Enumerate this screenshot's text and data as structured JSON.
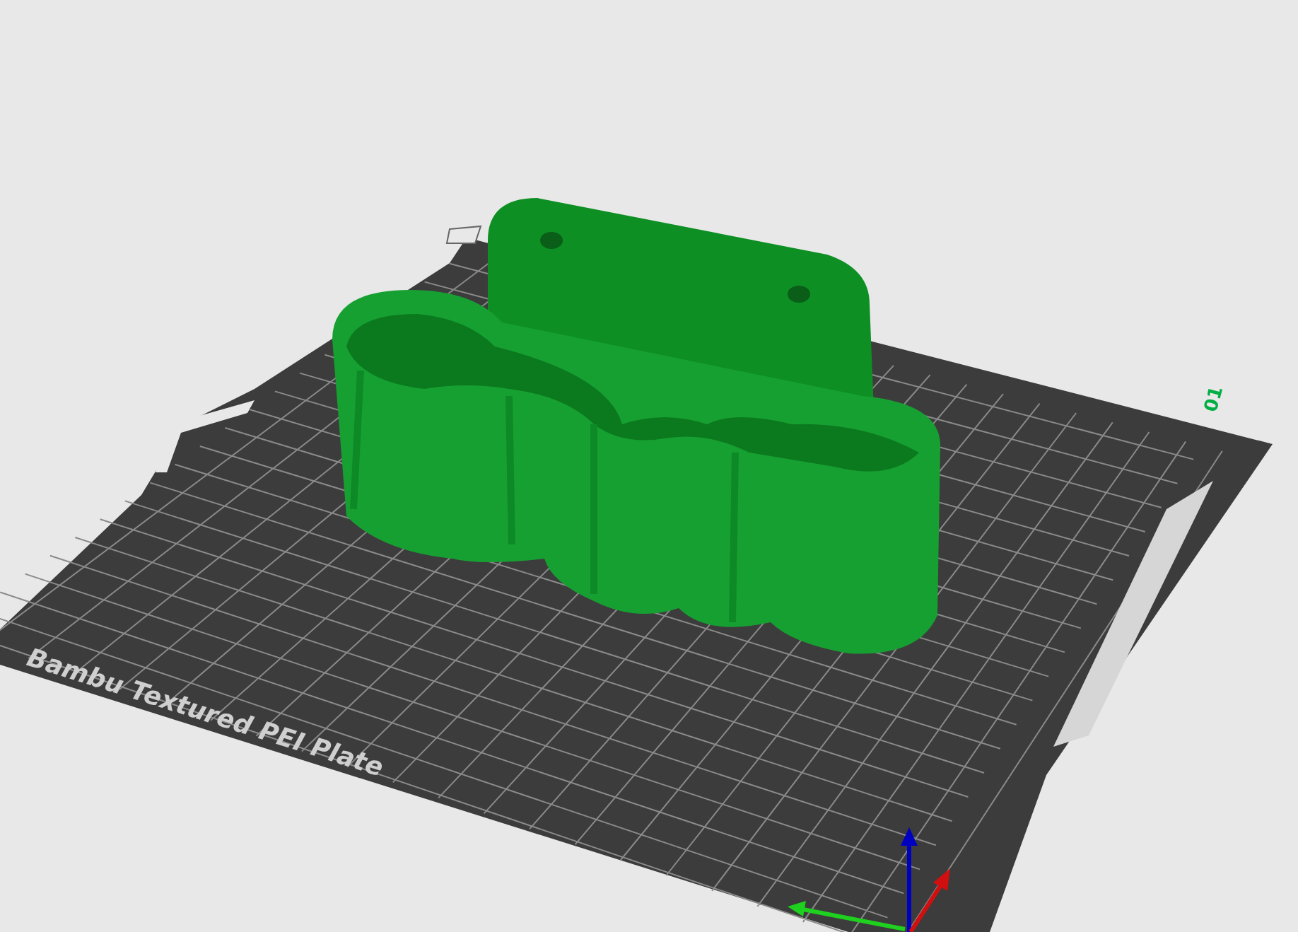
{
  "plate": {
    "name": "Bambu Textured PEI Plate",
    "number": "01"
  }
}
